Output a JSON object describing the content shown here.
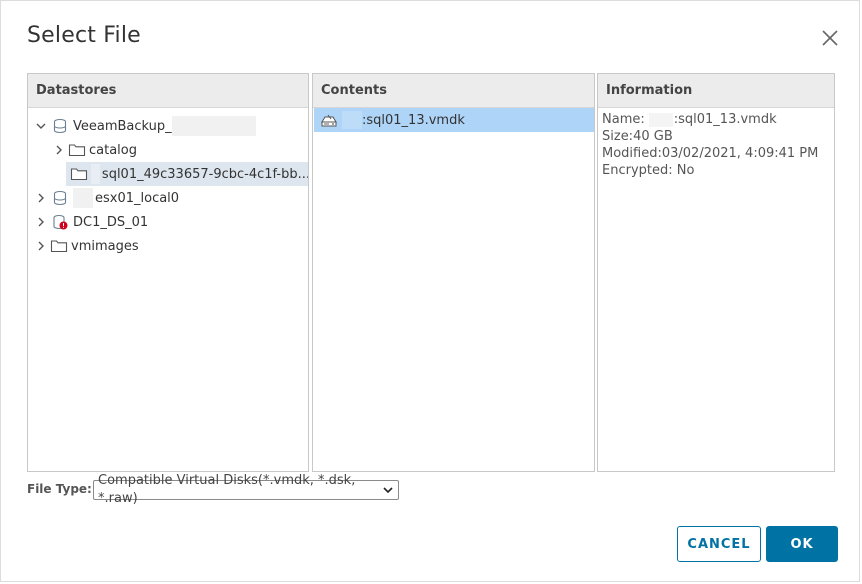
{
  "dialog": {
    "title": "Select File",
    "close_icon": "close-icon"
  },
  "panes": {
    "datastores": {
      "header": "Datastores"
    },
    "contents": {
      "header": "Contents"
    },
    "information": {
      "header": "Information"
    }
  },
  "tree": {
    "items": [
      {
        "label": "VeeamBackup_",
        "icon": "datastore-icon",
        "expanded": true
      },
      {
        "label": "catalog",
        "icon": "folder-icon",
        "expanded": false
      },
      {
        "label": "sql01_49c33657-9cbc-4c1f-bb...",
        "icon": "folder-icon",
        "selected": true
      },
      {
        "label": "esx01_local0",
        "icon": "datastore-icon",
        "expanded": false
      },
      {
        "label": "DC1_DS_01",
        "icon": "datastore-error-icon",
        "expanded": false
      },
      {
        "label": "vmimages",
        "icon": "folder-icon",
        "expanded": false
      }
    ]
  },
  "contents": {
    "items": [
      {
        "label": ":sql01_13.vmdk",
        "icon": "virtual-disk-icon",
        "selected": true
      }
    ]
  },
  "information": {
    "name_label": "Name:",
    "name_value": ":sql01_13.vmdk",
    "size_label": "Size:",
    "size_value": "40 GB",
    "modified_label": "Modified:",
    "modified_value": "03/02/2021, 4:09:41 PM",
    "encrypted_label": "Encrypted:",
    "encrypted_value": "No"
  },
  "file_type": {
    "label": "File Type:",
    "selected": "Compatible Virtual Disks(*.vmdk, *.dsk, *.raw)"
  },
  "buttons": {
    "cancel": "CANCEL",
    "ok": "OK"
  },
  "colors": {
    "accent": "#0072a3",
    "selected_content": "#aed4f7",
    "selected_tree": "#dde6ee",
    "error": "#d0021b"
  }
}
